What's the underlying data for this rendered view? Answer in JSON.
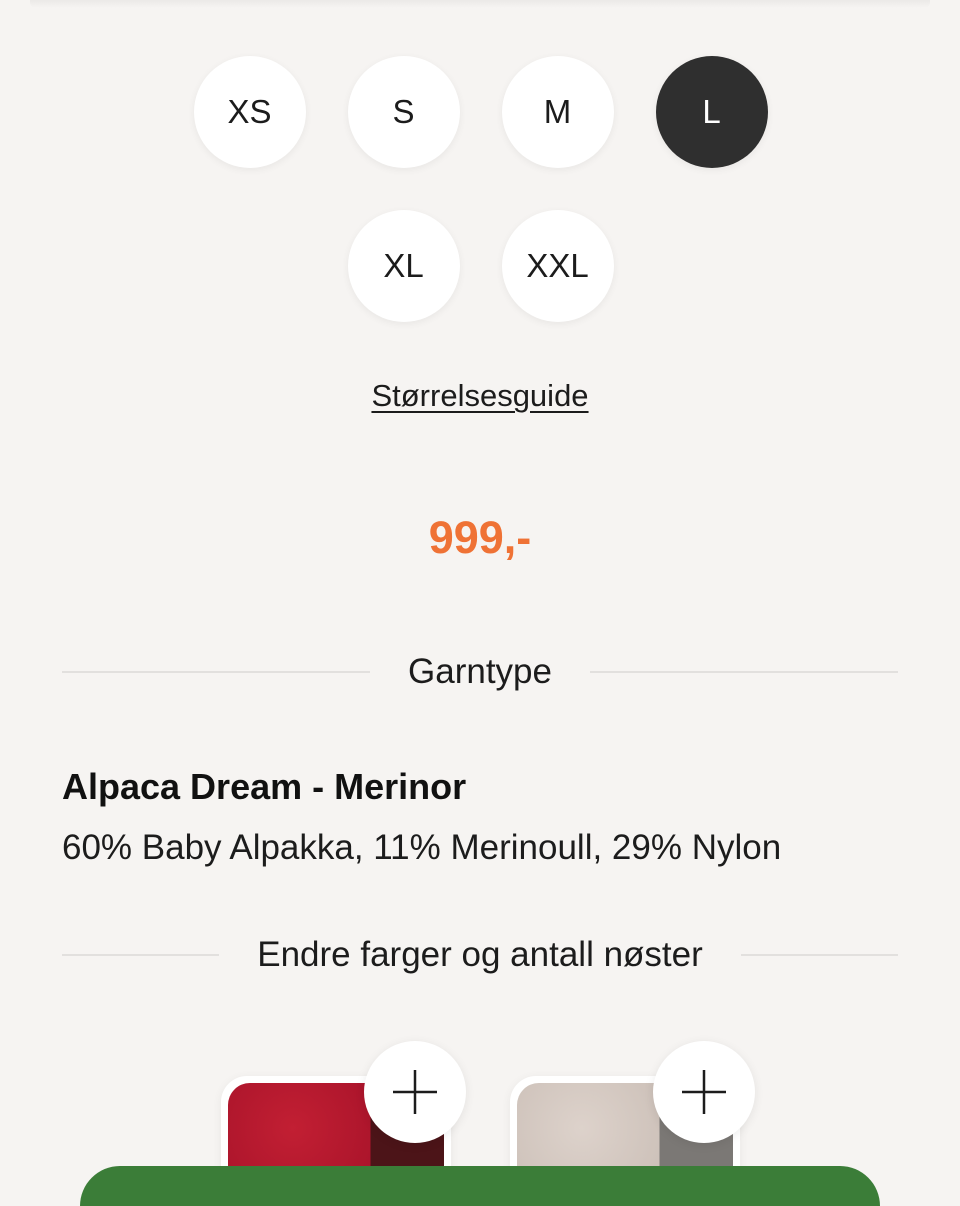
{
  "sizes": {
    "options": [
      "XS",
      "S",
      "M",
      "L",
      "XL",
      "XXL"
    ],
    "selected": "L"
  },
  "size_guide_label": "Størrelsesguide",
  "price": "999,-",
  "yarn": {
    "heading": "Garntype",
    "name": "Alpaca Dream - Merinor",
    "composition": "60% Baby Alpakka, 11% Merinoull, 29% Nylon"
  },
  "colors": {
    "heading": "Endre farger og antall nøster",
    "swatches": [
      {
        "color_name": "red-swatch",
        "hex": "#b0172c"
      },
      {
        "color_name": "beige-swatch",
        "hex": "#d3c7bf"
      }
    ]
  },
  "accent_colors": {
    "price": "#ef7235",
    "selected_size": "#2f2f2f",
    "cta": "#3b7d38"
  },
  "icons": {
    "add": "plus-icon"
  }
}
